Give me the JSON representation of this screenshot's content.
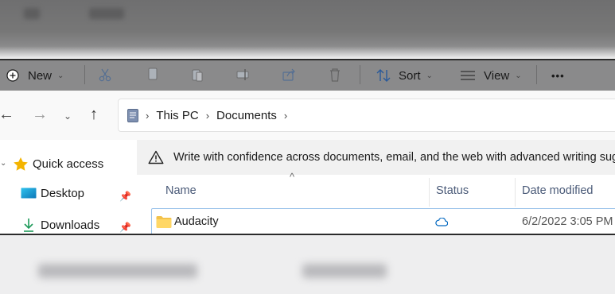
{
  "toolbar": {
    "new_label": "New",
    "sort_label": "Sort",
    "view_label": "View",
    "more_label": "•••"
  },
  "address": {
    "segments": [
      "This PC",
      "Documents"
    ]
  },
  "infobar": {
    "message": "Write with confidence across documents, email, and the web with advanced writing sug"
  },
  "sidebar": {
    "quick_access": "Quick access",
    "items": [
      {
        "label": "Desktop",
        "icon": "desktop-icon"
      },
      {
        "label": "Downloads",
        "icon": "download-arrow-icon"
      }
    ]
  },
  "columns": {
    "name": "Name",
    "status": "Status",
    "date": "Date modified"
  },
  "files": [
    {
      "name": "Audacity",
      "status": "cloud",
      "date": "6/2/2022 3:05 PM"
    }
  ],
  "colors": {
    "accent": "#0067c0",
    "folder": "#f3c24b",
    "star": "#f4b400",
    "selection_border": "#99c2ea"
  }
}
